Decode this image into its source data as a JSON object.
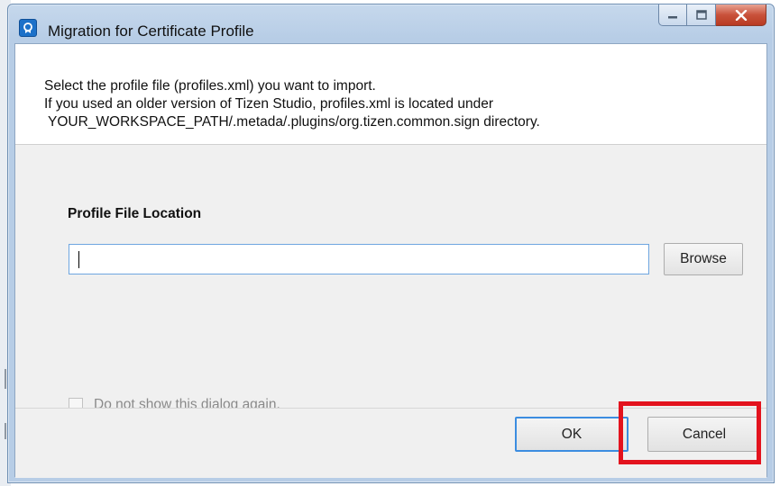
{
  "window": {
    "title": "Migration for Certificate Profile",
    "icons": {
      "app": "tizen-certificate-icon",
      "minimize": "minimize-icon",
      "maximize": "maximize-icon",
      "close": "close-icon"
    }
  },
  "header": {
    "line1": "Select the profile file (profiles.xml) you want to import.",
    "line2": "If you used an older version of Tizen Studio, profiles.xml is located under",
    "line3": "YOUR_WORKSPACE_PATH/.metada/.plugins/org.tizen.common.sign directory."
  },
  "form": {
    "section_title": "Profile File Location",
    "location_value": "",
    "browse_label": "Browse",
    "dont_show_label": "Do not show this dialog again.",
    "dont_show_checked": false
  },
  "footer": {
    "ok_label": "OK",
    "cancel_label": "Cancel"
  },
  "colors": {
    "highlight": "#e3131e",
    "focus_border": "#3c8de0"
  }
}
